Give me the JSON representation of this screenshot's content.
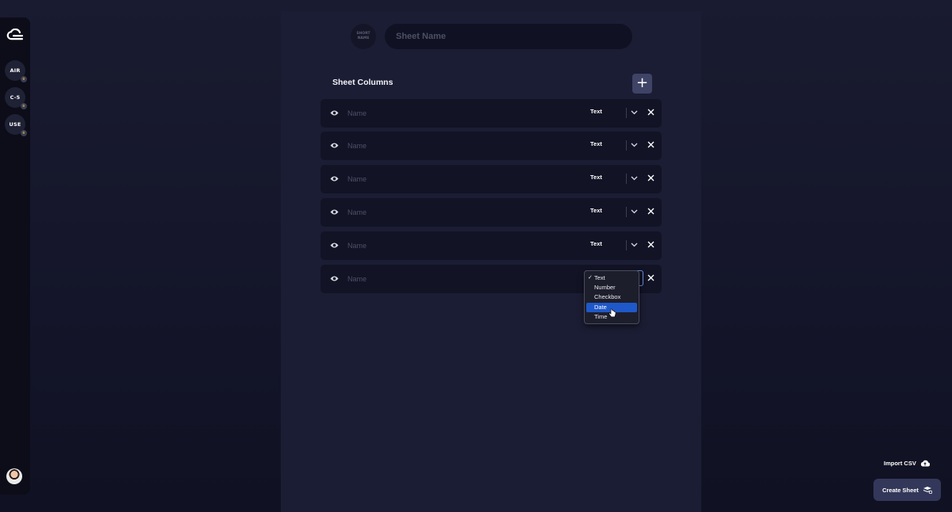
{
  "sidebar": {
    "workspaces": [
      {
        "label": "AIR"
      },
      {
        "label": "C-5"
      },
      {
        "label": "USE"
      }
    ]
  },
  "sheet": {
    "short_name_placeholder": "SHORT NAME",
    "name_placeholder": "Sheet Name"
  },
  "columns_section": {
    "title": "Sheet Columns"
  },
  "columns": [
    {
      "placeholder": "Name",
      "type": "Text"
    },
    {
      "placeholder": "Name",
      "type": "Text"
    },
    {
      "placeholder": "Name",
      "type": "Text"
    },
    {
      "placeholder": "Name",
      "type": "Text"
    },
    {
      "placeholder": "Name",
      "type": "Text"
    },
    {
      "placeholder": "Name",
      "type": ""
    }
  ],
  "type_dropdown": {
    "options": [
      "Text",
      "Number",
      "Checkbox",
      "Date",
      "Time"
    ],
    "selected": "Text",
    "highlighted": "Date"
  },
  "actions": {
    "import_label": "Import CSV",
    "create_label": "Create Sheet"
  },
  "colors": {
    "background": "#191b30",
    "panel": "#1b1d34",
    "row": "#121325",
    "highlight": "#1f58c9",
    "button": "#33385a"
  }
}
